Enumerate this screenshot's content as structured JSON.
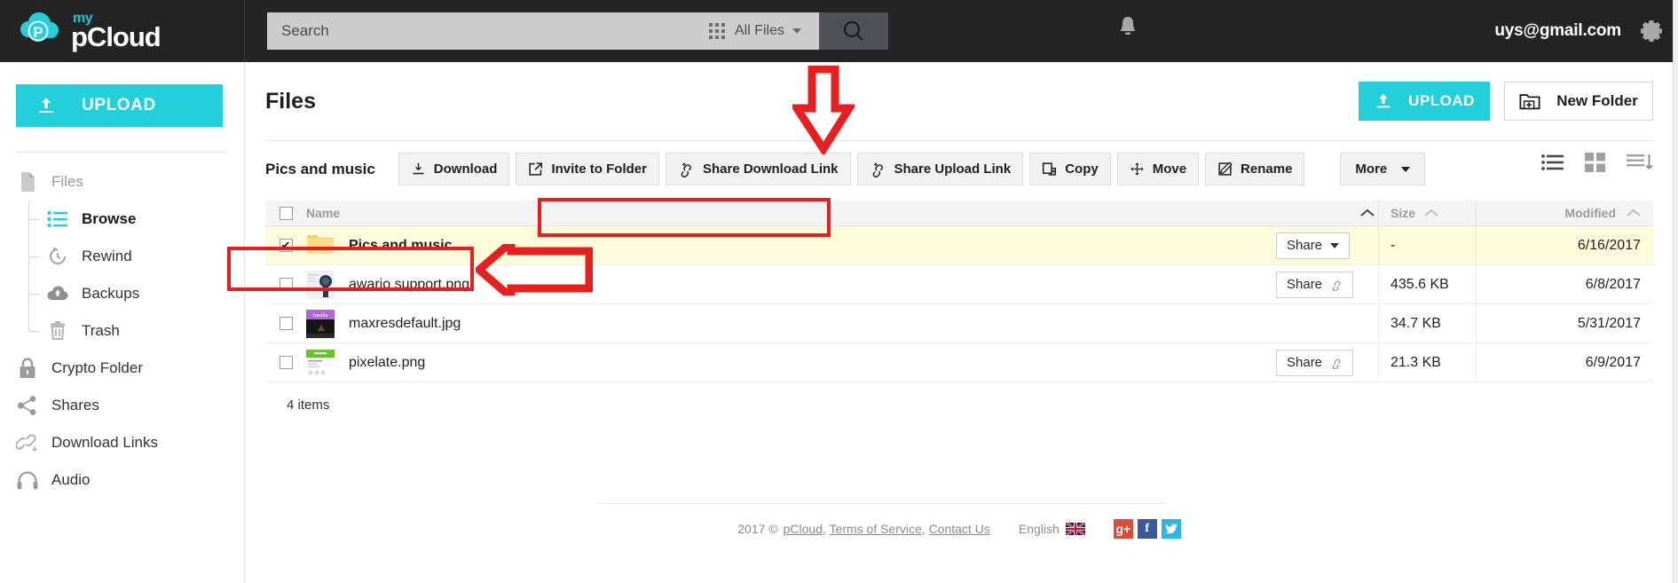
{
  "topbar": {
    "logo_my": "my",
    "logo_name": "pCloud",
    "search": {
      "value": "",
      "placeholder": "Search"
    },
    "scope_label": "All Files",
    "account_email": "uys@gmail.com",
    "icons": {
      "apps_grid": "apps-grid-icon",
      "search": "search-icon",
      "bell": "notifications-bell-icon",
      "gear": "settings-gear-icon"
    }
  },
  "sidebar": {
    "upload_label": "UPLOAD",
    "items": [
      {
        "label": "Files",
        "icon": "file-icon",
        "level": "root",
        "muted": true,
        "active": false
      },
      {
        "label": "Browse",
        "icon": "list-lines-icon",
        "level": "child",
        "muted": false,
        "active": true
      },
      {
        "label": "Rewind",
        "icon": "rewind-clock-icon",
        "level": "child",
        "muted": false,
        "active": false
      },
      {
        "label": "Backups",
        "icon": "cloud-upload-icon",
        "level": "child",
        "muted": false,
        "active": false
      },
      {
        "label": "Trash",
        "icon": "trash-icon",
        "level": "child",
        "muted": false,
        "active": false
      },
      {
        "label": "Crypto Folder",
        "icon": "lock-icon",
        "level": "root",
        "muted": false,
        "active": false
      },
      {
        "label": "Shares",
        "icon": "share-nodes-icon",
        "level": "root",
        "muted": false,
        "active": false
      },
      {
        "label": "Download Links",
        "icon": "link-download-icon",
        "level": "root",
        "muted": false,
        "active": false
      },
      {
        "label": "Audio",
        "icon": "headphones-icon",
        "level": "root",
        "muted": false,
        "active": false
      }
    ]
  },
  "main": {
    "page_title": "Files",
    "upload_label": "UPLOAD",
    "new_folder_label": "New Folder",
    "breadcrumb": "Pics and music",
    "toolbar_buttons": [
      {
        "label": "Download",
        "icon": "download-icon"
      },
      {
        "label": "Invite to Folder",
        "icon": "invite-external-icon"
      },
      {
        "label": "Share Download Link",
        "icon": "link-plus-icon"
      },
      {
        "label": "Share Upload Link",
        "icon": "link-plus-icon"
      },
      {
        "label": "Copy",
        "icon": "copy-icon"
      },
      {
        "label": "Move",
        "icon": "move-arrows-icon"
      },
      {
        "label": "Rename",
        "icon": "rename-pencil-icon"
      }
    ],
    "more_label": "More",
    "view_icons": [
      {
        "name": "list-view-icon",
        "active": true
      },
      {
        "name": "grid-view-icon",
        "active": false
      },
      {
        "name": "sort-order-icon",
        "active": false
      }
    ],
    "table": {
      "columns": [
        "Name",
        "Size",
        "Modified"
      ],
      "rows": [
        {
          "name": "Pics and music",
          "kind": "folder",
          "thumb": "folder-icon",
          "selected": true,
          "checked": true,
          "share_label": "Share",
          "share_style": "dropdown",
          "size": "-",
          "modified": "6/16/2017"
        },
        {
          "name": "awario support.png",
          "kind": "file",
          "thumb": "image-thumb-awario",
          "selected": false,
          "checked": false,
          "share_label": "Share",
          "share_style": "link",
          "size": "435.6 KB",
          "modified": "6/8/2017"
        },
        {
          "name": "maxresdefault.jpg",
          "kind": "file",
          "thumb": "image-thumb-maxres",
          "selected": false,
          "checked": false,
          "share_label": "",
          "share_style": "none",
          "size": "34.7 KB",
          "modified": "5/31/2017"
        },
        {
          "name": "pixelate.png",
          "kind": "file",
          "thumb": "image-thumb-pixelate",
          "selected": false,
          "checked": false,
          "share_label": "Share",
          "share_style": "link",
          "size": "21.3 KB",
          "modified": "6/9/2017"
        }
      ]
    },
    "items_count": "4 items"
  },
  "footer": {
    "copyright": "2017 ©",
    "link_pcloud": "pCloud",
    "sep1": ",",
    "link_terms": "Terms of Service",
    "sep2": ",",
    "link_contact": "Contact Us",
    "language": "English",
    "social": [
      {
        "name": "google-plus-icon",
        "glyph": "g+",
        "color": "#dd4b39"
      },
      {
        "name": "facebook-icon",
        "glyph": "f",
        "color": "#3b5998"
      },
      {
        "name": "twitter-icon",
        "glyph": "t",
        "color": "#2eb5e8"
      }
    ]
  },
  "annotations": {
    "highlight_color": "#e81f1f",
    "shapes": [
      {
        "name": "share-links-highlight-box",
        "target": "Share Download Link / Share Upload Link"
      },
      {
        "name": "selected-folder-highlight-box",
        "target": "Pics and music row"
      },
      {
        "name": "down-arrow-annotation",
        "target": "Share Download Link"
      },
      {
        "name": "left-arrow-annotation",
        "target": "Pics and music row"
      }
    ]
  },
  "colors": {
    "brand_cyan": "#22cfdb",
    "topbar_dark": "#242424",
    "selected_row": "#fcfbda",
    "annotation_red": "#e81f1f"
  }
}
